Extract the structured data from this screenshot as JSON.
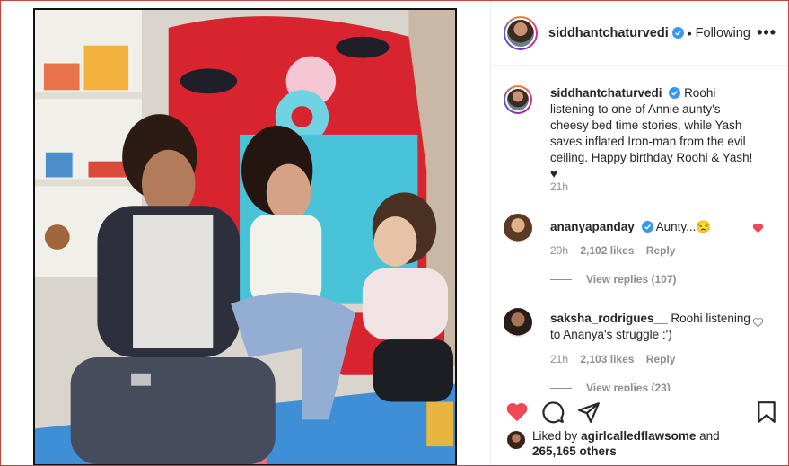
{
  "post": {
    "username": "siddhantchaturvedi",
    "follow_separator": "•",
    "follow_label": "Following",
    "more_label": "•••"
  },
  "caption": {
    "username": "siddhantchaturvedi",
    "text": "Roohi listening to one of Annie aunty's cheesy bed time stories, while Yash saves inflated Iron-man from the evil ceiling. Happy birthday Roohi & Yash! ♥",
    "time": "21h"
  },
  "comments": [
    {
      "username": "ananyapanday",
      "verified": true,
      "text": "Aunty...😒",
      "time": "20h",
      "likes": "2,102 likes",
      "reply_label": "Reply",
      "liked": true,
      "view_replies": "View replies (107)"
    },
    {
      "username": "saksha_rodrigues__",
      "verified": false,
      "text": "Roohi listening to Ananya's struggle :')",
      "time": "21h",
      "likes": "2,103 likes",
      "reply_label": "Reply",
      "liked": false,
      "view_replies": "View replies (23)"
    }
  ],
  "actions": {
    "icons": [
      "heart-filled-icon",
      "comment-icon",
      "share-icon",
      "save-icon"
    ],
    "liked_by_prefix": "Liked by",
    "liked_by_user": "agirlcalledflawsome",
    "liked_by_and": "and",
    "others_count": "265,165 others"
  },
  "colors": {
    "verified": "#3897f0",
    "heart": "#ed4956",
    "text": "#262626",
    "muted": "#8e8e8e"
  }
}
